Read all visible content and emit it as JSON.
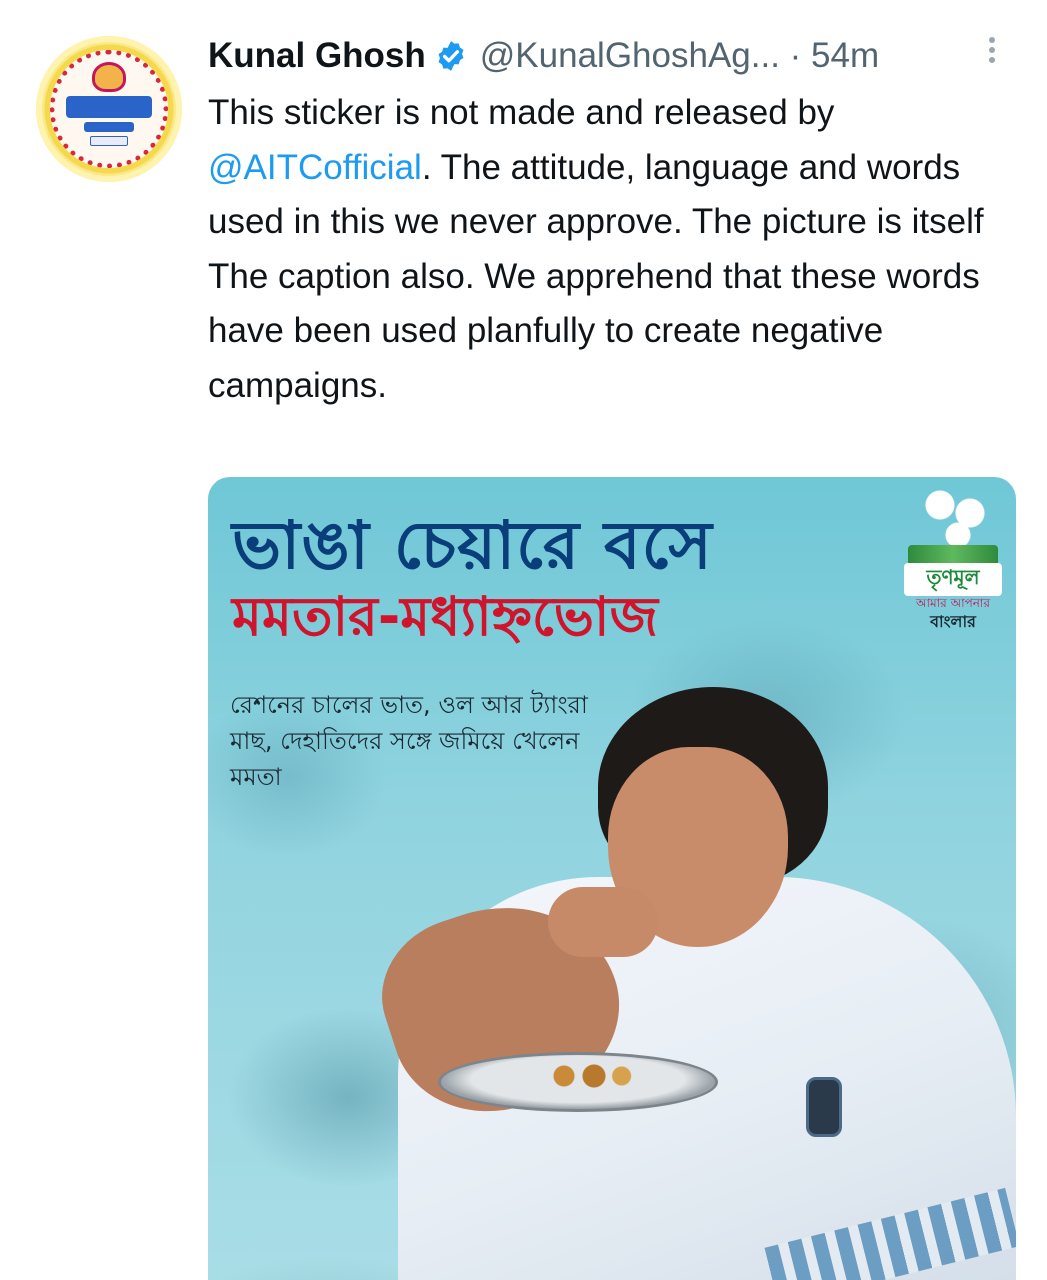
{
  "tweet": {
    "author_name": "Kunal Ghosh",
    "handle": "@KunalGhoshAg...",
    "separator": " · ",
    "time": "54m",
    "text_parts": [
      "This sticker is not made and released by ",
      "@AITCofficial",
      ". The attitude, language and words used in this we never approve. The picture is itself The caption also. We apprehend that these words have been used planfully to create negative campaigns."
    ]
  },
  "media": {
    "headline_line1": "ভাঙা চেয়ারে বসে",
    "headline_line2": "মমতার-মধ্যাহ্নভোজ",
    "subtext": "রেশনের চালের ভাত, ওল আর ট্যাংরা মাছ, দেহাতিদের সঙ্গে জমিয়ে খেলেন মমতা",
    "logo_name": "তৃণমূল",
    "logo_tagline1": "আমার আপনার",
    "logo_tagline2": "বাংলার"
  },
  "colors": {
    "mention": "#1d9bf0",
    "verified": "#1d9bf0",
    "secondary_text": "#536471",
    "headline1": "#0a3e7a",
    "headline2": "#d0142b"
  },
  "icons": [
    "verified-badge-icon",
    "more-options-icon"
  ]
}
